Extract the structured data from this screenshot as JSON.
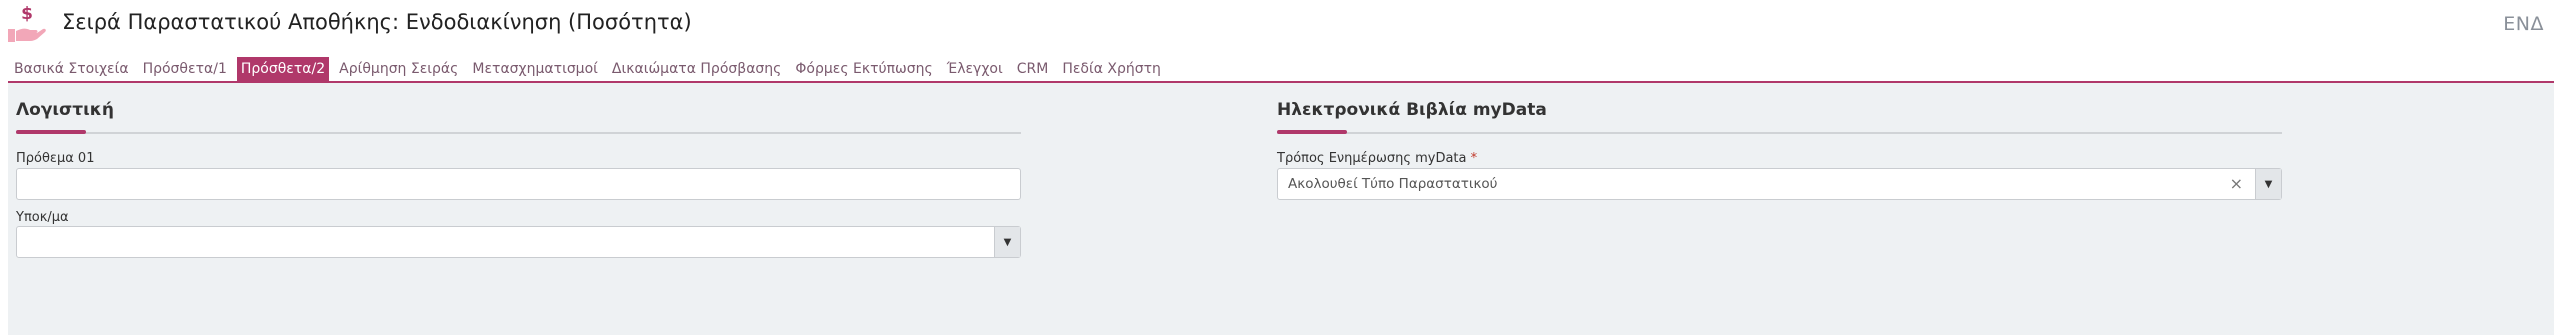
{
  "header": {
    "title": "Σειρά Παραστατικού Αποθήκης: Ενδοδιακίνηση (Ποσότητα)",
    "code": "ΕΝΔ",
    "icon": "money-hand-icon",
    "accent_color": "#b0386a"
  },
  "tabs": [
    {
      "label": "Βασικά Στοιχεία",
      "active": false
    },
    {
      "label": "Πρόσθετα/1",
      "active": false
    },
    {
      "label": "Πρόσθετα/2",
      "active": true
    },
    {
      "label": "Αρίθμηση Σειράς",
      "active": false
    },
    {
      "label": "Μετασχηματισμοί",
      "active": false
    },
    {
      "label": "Δικαιώματα Πρόσβασης",
      "active": false
    },
    {
      "label": "Φόρμες Εκτύπωσης",
      "active": false
    },
    {
      "label": "Έλεγχοι",
      "active": false
    },
    {
      "label": "CRM",
      "active": false
    },
    {
      "label": "Πεδία Χρήστη",
      "active": false
    }
  ],
  "left_section": {
    "title": "Λογιστική",
    "prothema_label": "Πρόθεμα 01",
    "prothema_value": "",
    "ypokma_label": "Υποκ/μα",
    "ypokma_value": ""
  },
  "right_section": {
    "title": "Ηλεκτρονικά Βιβλία myData",
    "update_mode_label": "Τρόπος Ενημέρωσης myData",
    "required_mark": "*",
    "update_mode_value": "Ακολουθεί Τύπο Παραστατικού",
    "clear_symbol": "×",
    "dropdown_arrow": "▼"
  }
}
